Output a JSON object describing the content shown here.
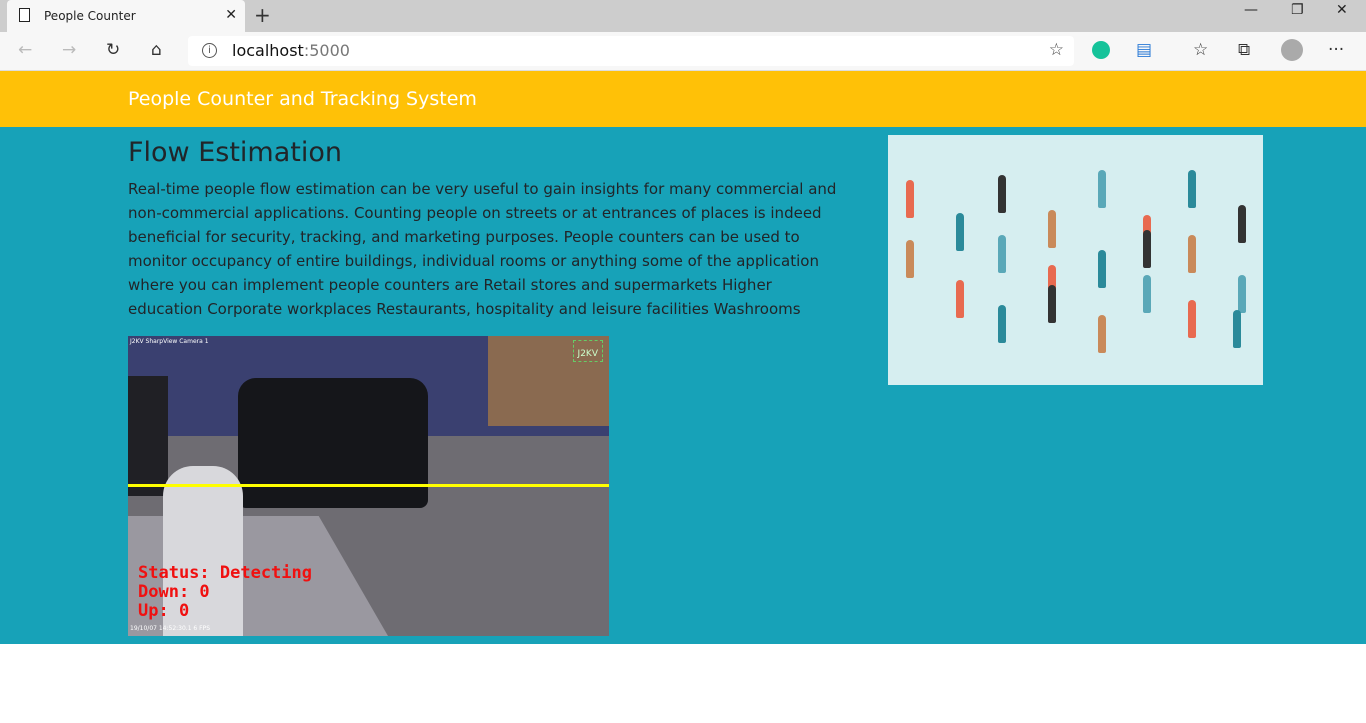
{
  "browser": {
    "tab_title": "People Counter",
    "url_host": "localhost",
    "url_port": ":5000"
  },
  "navbar": {
    "brand": "People Counter and Tracking System"
  },
  "main": {
    "heading": "Flow Estimation",
    "description": "Real-time people flow estimation can be very useful to gain insights for many commercial and non-commercial applications. Counting people on streets or at entrances of places is indeed beneficial for security, tracking, and marketing purposes. People counters can be used to monitor occupancy of entire buildings, individual rooms or anything some of the application where you can implement people counters are Retail stores and supermarkets Higher education Corporate workplaces Restaurants, hospitality and leisure facilities Washrooms",
    "video": {
      "camera_label": "J2KV SharpView Camera 1",
      "status": "Status: Detecting",
      "down": "Down: 0",
      "up": "Up: 0",
      "timestamp": "19/10/07 14:52:30.1 6 FPS",
      "logo": "J2KV",
      "line_color": "#ffff00"
    }
  },
  "colors": {
    "navbar": "#ffc107",
    "main_bg": "#17a2b8"
  }
}
